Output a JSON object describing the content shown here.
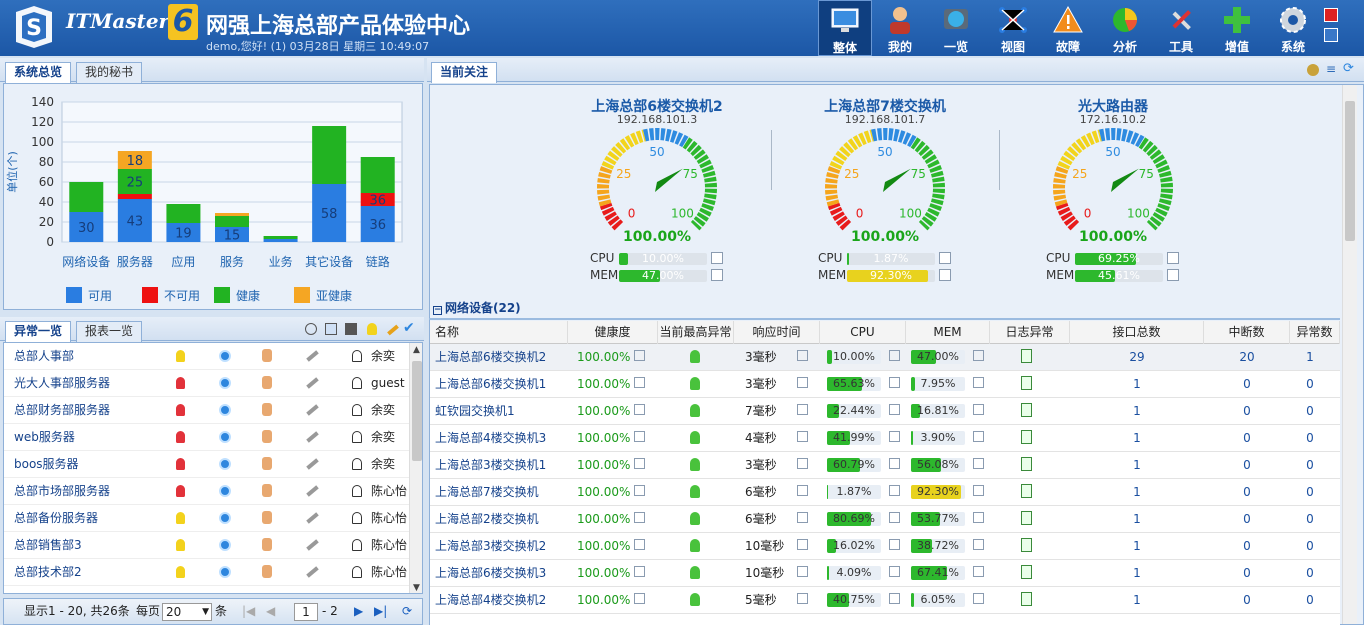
{
  "header": {
    "brand": "ITMaster",
    "brand_version": "6",
    "title": "网强上海总部产品体验中心",
    "welcome": "demo,您好! (1) 03月28日 星期三 10:49:07"
  },
  "nav": [
    {
      "label": "整体",
      "icon": "monitor-icon",
      "active": true
    },
    {
      "label": "我的",
      "icon": "user-icon",
      "active": false
    },
    {
      "label": "一览",
      "icon": "globe-icon",
      "active": false
    },
    {
      "label": "视图",
      "icon": "topology-icon",
      "active": false
    },
    {
      "label": "故障",
      "icon": "warning-icon",
      "active": false
    },
    {
      "label": "分析",
      "icon": "pie-chart-icon",
      "active": false
    },
    {
      "label": "工具",
      "icon": "tools-icon",
      "active": false
    },
    {
      "label": "增值",
      "icon": "plus-icon",
      "active": false
    },
    {
      "label": "系统",
      "icon": "gear-icon",
      "active": false
    }
  ],
  "left_tabs": {
    "overview": "系统总览",
    "secretary": "我的秘书"
  },
  "chart_data": {
    "type": "bar",
    "ylabel": "单位(个)",
    "ylim": [
      0,
      140
    ],
    "yticks": [
      0,
      20,
      40,
      60,
      80,
      100,
      120,
      140
    ],
    "categories": [
      "网络设备",
      "服务器",
      "应用",
      "服务",
      "业务",
      "其它设备",
      "链路"
    ],
    "series": [
      {
        "name": "可用",
        "color": "#2a7de1",
        "values": [
          30,
          43,
          19,
          15,
          3,
          58,
          36
        ]
      },
      {
        "name": "不可用",
        "color": "#ee1111",
        "values": [
          0,
          5,
          0,
          0,
          0,
          0,
          13
        ]
      },
      {
        "name": "健康",
        "color": "#22b322",
        "values": [
          30,
          25,
          19,
          11,
          3,
          58,
          36
        ]
      },
      {
        "name": "亚健康",
        "color": "#f5a623",
        "values": [
          0,
          18,
          0,
          3,
          0,
          0,
          0
        ]
      }
    ],
    "data_labels": [
      [
        "30",
        "30"
      ],
      [
        "43",
        "",
        "25",
        "18"
      ],
      [
        "19",
        "19"
      ],
      [
        "15"
      ],
      [],
      [
        "58",
        "58"
      ],
      [
        "36",
        "36"
      ]
    ]
  },
  "exception_tabs": {
    "exceptions": "异常一览",
    "reports": "报表一览"
  },
  "exceptions": [
    {
      "name": "总部人事部",
      "light": "yellow",
      "user": "余奕"
    },
    {
      "name": "光大人事部服务器",
      "light": "red",
      "user": "guest"
    },
    {
      "name": "总部财务部服务器",
      "light": "red",
      "user": "余奕"
    },
    {
      "name": "web服务器",
      "light": "red",
      "user": "余奕"
    },
    {
      "name": "boos服务器",
      "light": "red",
      "user": "余奕"
    },
    {
      "name": "总部市场部服务器",
      "light": "red",
      "user": "陈心怡"
    },
    {
      "name": "总部备份服务器",
      "light": "yellow",
      "user": "陈心怡"
    },
    {
      "name": "总部销售部3",
      "light": "yellow",
      "user": "陈心怡"
    },
    {
      "name": "总部技术部2",
      "light": "yellow",
      "user": "陈心怡"
    }
  ],
  "pager": {
    "summary": "显示1 - 20, 共26条",
    "per_page_label": "每页",
    "per_page": "20",
    "unit": "条",
    "page": "1",
    "total_pages": "- 2"
  },
  "focus_tab": "当前关注",
  "gauges": [
    {
      "title": "上海总部6楼交换机2",
      "ip": "192.168.101.3",
      "health": "100.00%",
      "cpu_label": "CPU",
      "cpu": "10.00%",
      "cpu_val": 10,
      "cpu_color": "#2db82d",
      "mem_label": "MEM",
      "mem": "47.00%",
      "mem_val": 47,
      "mem_color": "#2db82d"
    },
    {
      "title": "上海总部7楼交换机",
      "ip": "192.168.101.7",
      "health": "100.00%",
      "cpu_label": "CPU",
      "cpu": "1.87%",
      "cpu_val": 1.87,
      "cpu_color": "#2db82d",
      "mem_label": "MEM",
      "mem": "92.30%",
      "mem_val": 92.3,
      "mem_color": "#e8d21e"
    },
    {
      "title": "光大路由器",
      "ip": "172.16.10.2",
      "health": "100.00%",
      "cpu_label": "CPU",
      "cpu": "69.25%",
      "cpu_val": 69.25,
      "cpu_color": "#2db82d",
      "mem_label": "MEM",
      "mem": "45.61%",
      "mem_val": 45.61,
      "mem_color": "#2db82d"
    }
  ],
  "gauge_ticks": [
    "0",
    "25",
    "50",
    "75",
    "100"
  ],
  "net_section": "网络设备(22)",
  "grid_headers": [
    "名称",
    "健康度",
    "当前最高异常",
    "响应时间",
    "CPU",
    "MEM",
    "日志异常",
    "接口总数",
    "中断数",
    "异常数"
  ],
  "grid_rows": [
    {
      "name": "上海总部6楼交换机2",
      "health": "100.00%",
      "resp": "3毫秒",
      "cpu": "10.00%",
      "cpu_v": 10,
      "mem": "47.00%",
      "mem_v": 47,
      "mem_c": "#2db82d",
      "ifs": "29",
      "down": "20",
      "err": "1"
    },
    {
      "name": "上海总部6楼交换机1",
      "health": "100.00%",
      "resp": "3毫秒",
      "cpu": "65.63%",
      "cpu_v": 65.63,
      "mem": "7.95%",
      "mem_v": 7.95,
      "mem_c": "#2db82d",
      "ifs": "1",
      "down": "0",
      "err": "0"
    },
    {
      "name": "虹钦园交换机1",
      "health": "100.00%",
      "resp": "7毫秒",
      "cpu": "22.44%",
      "cpu_v": 22.44,
      "mem": "16.81%",
      "mem_v": 16.81,
      "mem_c": "#2db82d",
      "ifs": "1",
      "down": "0",
      "err": "0"
    },
    {
      "name": "上海总部4楼交换机3",
      "health": "100.00%",
      "resp": "4毫秒",
      "cpu": "41.99%",
      "cpu_v": 41.99,
      "mem": "3.90%",
      "mem_v": 3.9,
      "mem_c": "#2db82d",
      "ifs": "1",
      "down": "0",
      "err": "0"
    },
    {
      "name": "上海总部3楼交换机1",
      "health": "100.00%",
      "resp": "3毫秒",
      "cpu": "60.79%",
      "cpu_v": 60.79,
      "mem": "56.08%",
      "mem_v": 56.08,
      "mem_c": "#2db82d",
      "ifs": "1",
      "down": "0",
      "err": "0"
    },
    {
      "name": "上海总部7楼交换机",
      "health": "100.00%",
      "resp": "6毫秒",
      "cpu": "1.87%",
      "cpu_v": 1.87,
      "mem": "92.30%",
      "mem_v": 92.3,
      "mem_c": "#e8d21e",
      "ifs": "1",
      "down": "0",
      "err": "0"
    },
    {
      "name": "上海总部2楼交换机",
      "health": "100.00%",
      "resp": "6毫秒",
      "cpu": "80.69%",
      "cpu_v": 80.69,
      "mem": "53.77%",
      "mem_v": 53.77,
      "mem_c": "#2db82d",
      "ifs": "1",
      "down": "0",
      "err": "0"
    },
    {
      "name": "上海总部3楼交换机2",
      "health": "100.00%",
      "resp": "10毫秒",
      "cpu": "16.02%",
      "cpu_v": 16.02,
      "mem": "38.72%",
      "mem_v": 38.72,
      "mem_c": "#2db82d",
      "ifs": "1",
      "down": "0",
      "err": "0"
    },
    {
      "name": "上海总部6楼交换机3",
      "health": "100.00%",
      "resp": "10毫秒",
      "cpu": "4.09%",
      "cpu_v": 4.09,
      "mem": "67.41%",
      "mem_v": 67.41,
      "mem_c": "#2db82d",
      "ifs": "1",
      "down": "0",
      "err": "0"
    },
    {
      "name": "上海总部4楼交换机2",
      "health": "100.00%",
      "resp": "5毫秒",
      "cpu": "40.75%",
      "cpu_v": 40.75,
      "mem": "6.05%",
      "mem_v": 6.05,
      "mem_c": "#2db82d",
      "ifs": "1",
      "down": "0",
      "err": "0"
    }
  ]
}
